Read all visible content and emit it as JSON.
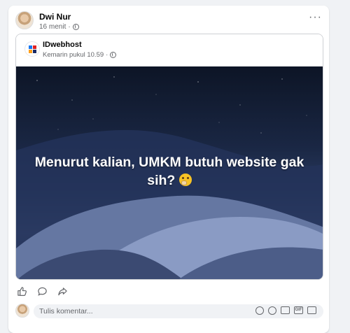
{
  "post": {
    "author": "Dwi Nur",
    "time": "16 menit",
    "separator": "·",
    "more_icon": "more-horizontal-icon"
  },
  "shared_post": {
    "page_name": "IDwebhost",
    "time": "Kemarin pukul 10.59",
    "separator": "·",
    "quote_text": "Menurut kalian, UMKM butuh website gak sih?",
    "emoji": "thinking-face-emoji",
    "logo_colors": [
      "#1877f2",
      "#e02020",
      "#ff9f1a",
      "#1a2b66"
    ]
  },
  "actions": [
    "like-icon",
    "comment-icon",
    "share-icon"
  ],
  "comment": {
    "placeholder": "Tulis komentar...",
    "icons": [
      "avatar-sticker-icon",
      "emoji-icon",
      "camera-icon",
      "gif-icon",
      "sticker-icon"
    ],
    "gif_label": "GIF"
  }
}
